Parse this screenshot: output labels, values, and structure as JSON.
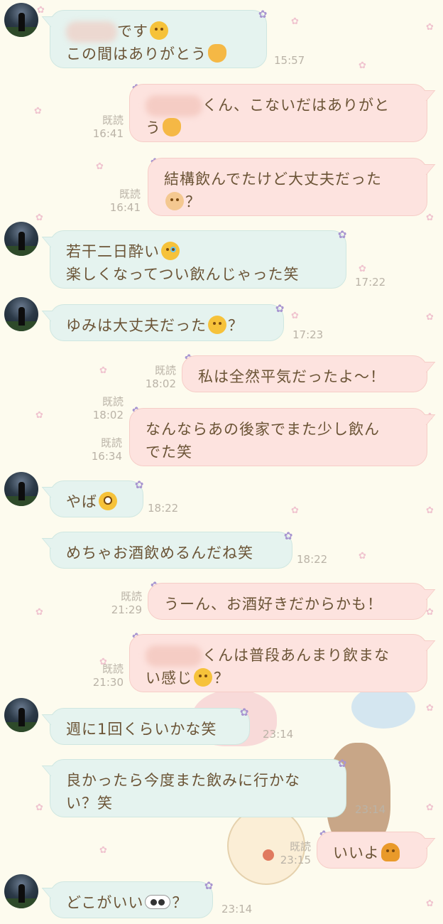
{
  "chat": {
    "messages": [
      {
        "side": "in",
        "name_hidden": true,
        "text": "です",
        "line2": "この間はありがとう",
        "time": "15:57"
      },
      {
        "side": "out",
        "name_hidden": true,
        "text": "くん、こないだはありがと",
        "line2": "う",
        "read": "既読",
        "time": "16:41"
      },
      {
        "side": "out",
        "text": "結構飲んでたけど大丈夫だった",
        "line2": "？",
        "read": "既読",
        "time": "16:41"
      },
      {
        "side": "in",
        "text": "若干二日酔い",
        "line2": "楽しくなってつい飲んじゃった笑",
        "time": "17:22"
      },
      {
        "side": "in",
        "text": "ゆみは大丈夫だった",
        "suffix": "？",
        "time": "17:23"
      },
      {
        "side": "out",
        "text": "私は全然平気だったよ〜！",
        "read": "既読",
        "time": "18:02"
      },
      {
        "side": "out",
        "text": "なんならあの後家でまた少し飲ん",
        "line2": "でた笑",
        "read": "既読",
        "time": "18:02",
        "read2": "既読",
        "time2": "16:34"
      },
      {
        "side": "in",
        "text": "やば",
        "time": "18:22"
      },
      {
        "side": "in",
        "text": "めちゃお酒飲めるんだね笑",
        "time": "18:22"
      },
      {
        "side": "out",
        "text": "うーん、お酒好きだからかも！",
        "read": "既読",
        "time": "21:29"
      },
      {
        "side": "out",
        "name_hidden": true,
        "text": "くんは普段あんまり飲まな",
        "line2": "い感じ",
        "suffix": "？",
        "read": "既読",
        "time": "21:30"
      },
      {
        "side": "in",
        "text": "週に1回くらいかな笑",
        "time": "23:14"
      },
      {
        "side": "in",
        "text": "良かったら今度また飲みに行かな",
        "line2": "い？笑",
        "time": "23:14"
      },
      {
        "side": "out",
        "text": "いいよ",
        "read": "既読",
        "time": "23:15"
      },
      {
        "side": "in",
        "text": "どこがいい",
        "suffix": "？",
        "time": "23:14"
      }
    ]
  },
  "icons": {
    "emoji": [
      "laughing-face",
      "raised-hands",
      "clapping-hands",
      "baby-face",
      "tears-of-joy",
      "relieved-face",
      "flushed-face",
      "monocle-face",
      "woman-raising-hand",
      "eyes"
    ],
    "decoration": "flower-sticker"
  },
  "colors": {
    "background": "#fdfbee",
    "incoming_bubble": "#e5f3ef",
    "outgoing_bubble": "#fde3df",
    "text": "#6b5436",
    "meta_text": "#bab3a7"
  }
}
